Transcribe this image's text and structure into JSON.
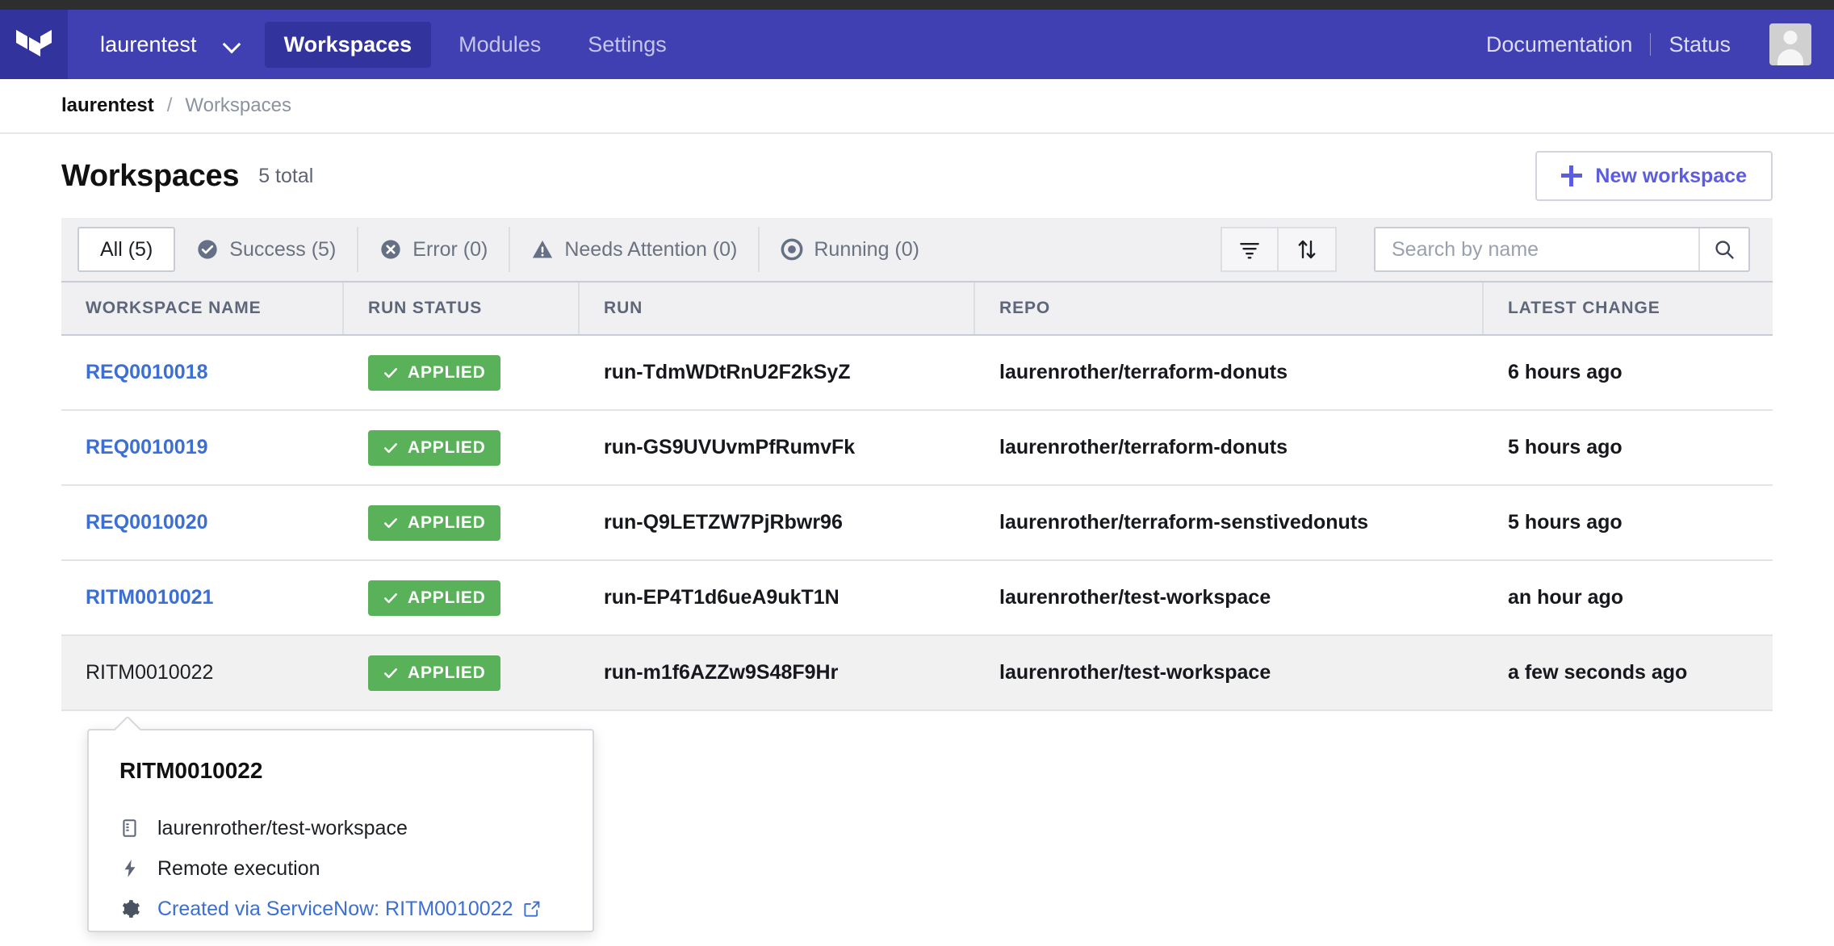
{
  "navbar": {
    "logo_icon": "terraform-logo-icon",
    "org_name": "laurentest",
    "org_chevron_icon": "chevron-down-icon",
    "links": [
      {
        "label": "Workspaces",
        "active": true
      },
      {
        "label": "Modules",
        "active": false
      },
      {
        "label": "Settings",
        "active": false
      }
    ],
    "documentation_label": "Documentation",
    "status_label": "Status",
    "avatar_icon": "user-avatar-icon"
  },
  "breadcrumb": {
    "root": "laurentest",
    "separator": "/",
    "current": "Workspaces"
  },
  "header": {
    "title": "Workspaces",
    "total": "5 total",
    "new_workspace_label": "New workspace",
    "new_workspace_icon": "plus-icon"
  },
  "toolbar": {
    "tabs": [
      {
        "label": "All (5)",
        "icon": "none",
        "active": true
      },
      {
        "label": "Success (5)",
        "icon": "check-circle-icon",
        "active": false
      },
      {
        "label": "Error (0)",
        "icon": "x-circle-icon",
        "active": false
      },
      {
        "label": "Needs Attention (0)",
        "icon": "alert-triangle-icon",
        "active": false
      },
      {
        "label": "Running (0)",
        "icon": "target-circle-icon",
        "active": false
      }
    ],
    "filter_icon": "filter-icon",
    "sort_icon": "sort-arrows-icon",
    "search_placeholder": "Search by name",
    "search_value": "",
    "search_icon": "search-icon"
  },
  "table": {
    "columns": [
      "WORKSPACE NAME",
      "RUN STATUS",
      "RUN",
      "REPO",
      "LATEST CHANGE"
    ],
    "rows": [
      {
        "name": "REQ0010018",
        "name_is_link": true,
        "status": "APPLIED",
        "status_color": "#59b259",
        "run": "run-TdmWDtRnU2F2kSyZ",
        "repo": "laurenrother/terraform-donuts",
        "latest_change": "6 hours ago",
        "highlighted": false
      },
      {
        "name": "REQ0010019",
        "name_is_link": true,
        "status": "APPLIED",
        "status_color": "#59b259",
        "run": "run-GS9UVUvmPfRumvFk",
        "repo": "laurenrother/terraform-donuts",
        "latest_change": "5 hours ago",
        "highlighted": false
      },
      {
        "name": "REQ0010020",
        "name_is_link": true,
        "status": "APPLIED",
        "status_color": "#59b259",
        "run": "run-Q9LETZW7PjRbwr96",
        "repo": "laurenrother/terraform-senstivedonuts",
        "latest_change": "5 hours ago",
        "highlighted": false
      },
      {
        "name": "RITM0010021",
        "name_is_link": true,
        "status": "APPLIED",
        "status_color": "#59b259",
        "run": "run-EP4T1d6ueA9ukT1N",
        "repo": "laurenrother/test-workspace",
        "latest_change": "an hour ago",
        "highlighted": false
      },
      {
        "name": "RITM0010022",
        "name_is_link": false,
        "status": "APPLIED",
        "status_color": "#59b259",
        "run": "run-m1f6AZZw9S48F9Hr",
        "repo": "laurenrother/test-workspace",
        "latest_change": "a few seconds ago",
        "highlighted": true
      }
    ]
  },
  "popover": {
    "title": "RITM0010022",
    "repo_icon": "book-icon",
    "repo": "laurenrother/test-workspace",
    "execution_icon": "lightning-bolt-icon",
    "execution": "Remote execution",
    "settings_icon": "gear-icon",
    "link_label": "Created via ServiceNow: RITM0010022",
    "link_external_icon": "external-link-icon"
  },
  "colors": {
    "nav_background": "#4040b2",
    "nav_active": "#33339e",
    "accent_purple": "#5c5ce0",
    "link_blue": "#3b6fd4",
    "success_green": "#59b259",
    "toolbar_grey": "#f0f0f2",
    "row_highlight": "#f1f1f2"
  }
}
